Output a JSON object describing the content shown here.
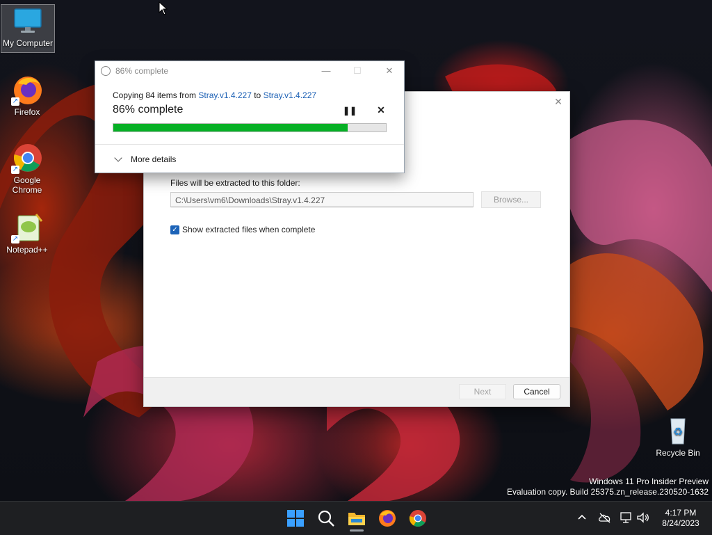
{
  "desktop": {
    "icons": [
      {
        "label": "My Computer"
      },
      {
        "label": "Firefox"
      },
      {
        "label": "Google Chrome"
      },
      {
        "label": "Notepad++"
      },
      {
        "label": "Recycle Bin"
      }
    ],
    "watermark": {
      "line1": "Windows 11 Pro Insider Preview",
      "line2": "Evaluation copy. Build 25375.zn_release.230520-1632"
    }
  },
  "progress_dialog": {
    "title": "86% complete",
    "copy_prefix": "Copying 84 items from ",
    "source": "Stray.v1.4.227",
    "copy_mid": " to ",
    "destination": "Stray.v1.4.227",
    "status": "86% complete",
    "progress_percent": 86,
    "pause_glyph": "❚❚",
    "cancel_glyph": "✕",
    "more_details_label": "More details",
    "min_glyph": "—",
    "max_glyph": "☐",
    "close_glyph": "✕"
  },
  "extract_wizard": {
    "close_glyph": "✕",
    "folder_label": "Files will be extracted to this folder:",
    "path_value": "C:\\Users\\vm6\\Downloads\\Stray.v1.4.227",
    "browse_label": "Browse...",
    "show_files_label": "Show extracted files when complete",
    "show_files_checked": true,
    "next_label": "Next",
    "cancel_label": "Cancel"
  },
  "taskbar": {
    "apps": [
      "start-icon",
      "search-icon",
      "file-explorer-icon",
      "firefox-icon",
      "chrome-icon"
    ],
    "time": "4:17 PM",
    "date": "8/24/2023"
  },
  "colors": {
    "progress_green": "#06b025",
    "link_blue": "#1a5fb4",
    "checkbox_blue": "#1c63b8"
  }
}
